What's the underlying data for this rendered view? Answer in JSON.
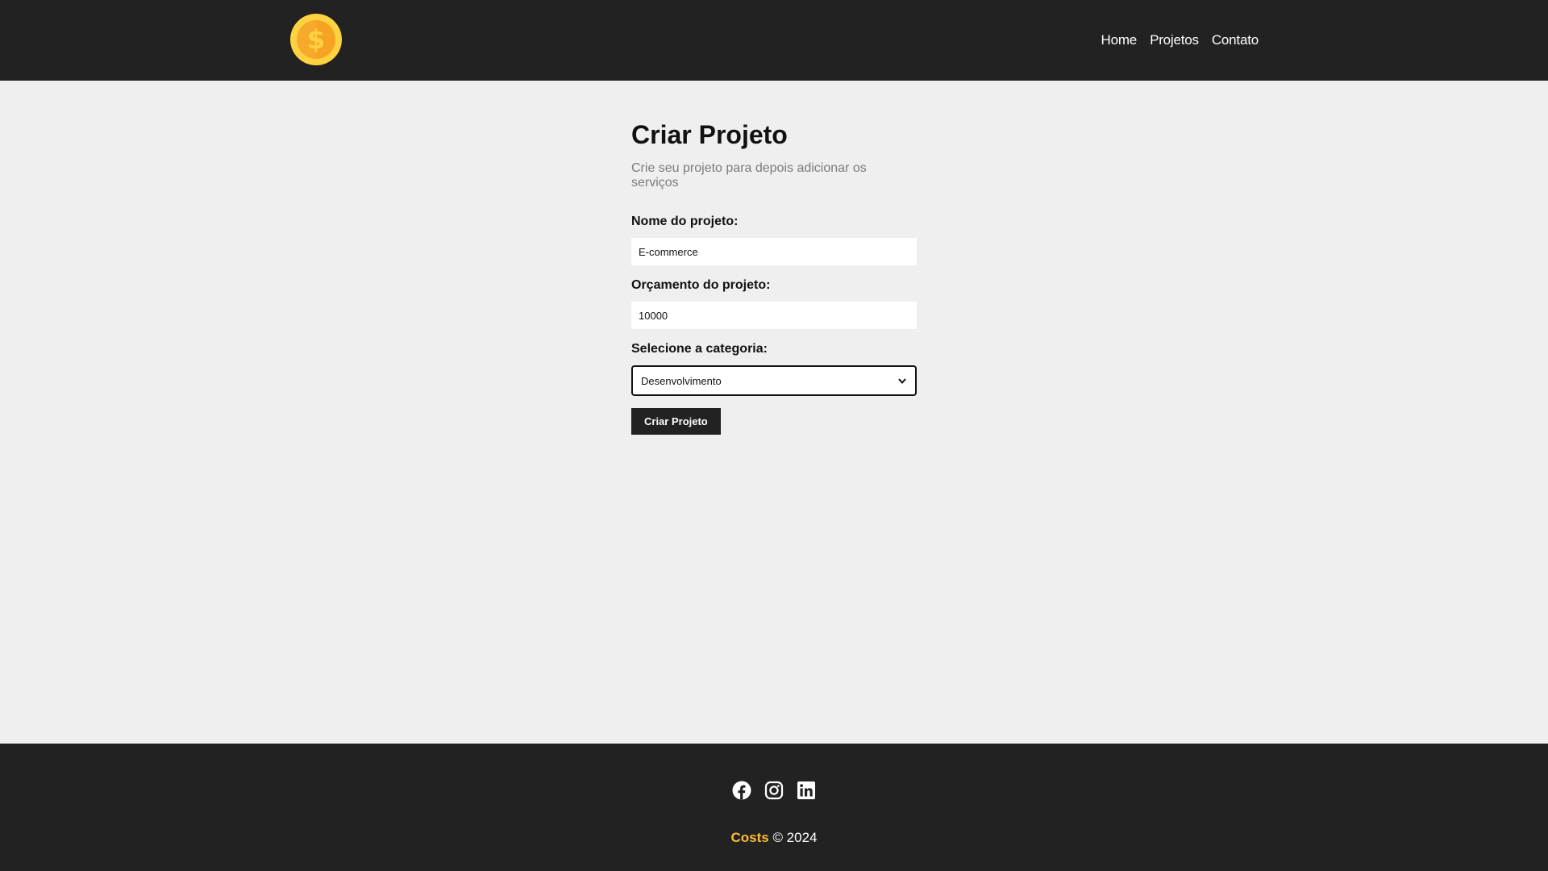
{
  "navbar": {
    "logo_icon": "dollar-coin-icon",
    "links": [
      {
        "label": "Home"
      },
      {
        "label": "Projetos"
      },
      {
        "label": "Contato"
      }
    ]
  },
  "form": {
    "title": "Criar Projeto",
    "subtitle": "Crie seu projeto para depois adicionar os serviços",
    "name_label": "Nome do projeto:",
    "name_value": "E-commerce",
    "budget_label": "Orçamento do projeto:",
    "budget_value": "10000",
    "category_label": "Selecione a categoria:",
    "category_selected": "Desenvolvimento",
    "submit_label": "Criar Projeto"
  },
  "footer": {
    "social_icons": [
      "facebook-icon",
      "instagram-icon",
      "linkedin-icon"
    ],
    "brand": "Costs",
    "copyright": "© 2024"
  },
  "colors": {
    "nav_bg": "#222222",
    "page_bg": "#efefef",
    "brand_accent": "#ffbb33",
    "coin_outer": "#ffd23f",
    "coin_inner": "#f7a92b"
  }
}
